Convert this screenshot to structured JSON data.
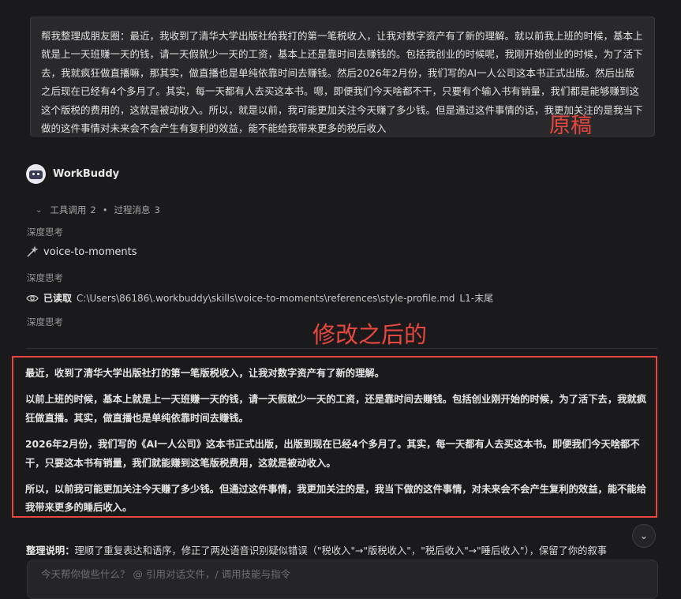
{
  "user_message": {
    "text": "帮我整理成朋友圈：最近，我收到了清华大学出版社给我打的第一笔税收入，让我对数字资产有了新的理解。就以前我上班的时候，基本上就是上一天班赚一天的钱，请一天假就少一天的工资，基本上还是靠时间去赚钱的。包括我创业的时候呢，我刚开始创业的时候，为了活下去，我就疯狂做直播嘛，那其实，做直播也是单纯依靠时间去赚钱。然后2026年2月份，我们写的AI一人公司这本书正式出版。然后出版之后现在已经有4个多月了。其实，每一天都有人去买这本书。嗯，即便我们今天啥都不干，只要有个输入书有销量，我们都是能够赚到这这个版税的费用的，这就是被动收入。所以，就是以前，我可能更加关注今天赚了多少钱。但是通过这件事情的话，我更加关注的是我当下做的这件事情对未来会不会产生有复利的效益，能不能给我带来更多的税后收入"
  },
  "annotations": {
    "original": "原稿",
    "modified": "修改之后的",
    "color": "#e8473f"
  },
  "assistant": {
    "name": "WorkBuddy",
    "tool_calls_label": "工具调用",
    "tool_calls_count": "2",
    "separator": "•",
    "process_label": "过程消息",
    "process_count": "3",
    "thinking_label": "深度思考",
    "skill_name": "voice-to-moments",
    "read_label": "已读取",
    "read_path": "C:\\Users\\86186\\.workbuddy\\skills\\voice-to-moments\\references\\style-profile.md",
    "read_range": "L1-末尾"
  },
  "result": {
    "paragraphs": [
      "最近，收到了清华大学出版社打的第一笔版税收入，让我对数字资产有了新的理解。",
      "以前上班的时候，基本上就是上一天班赚一天的钱，请一天假就少一天的工资，还是靠时间去赚钱。包括创业刚开始的时候，为了活下去，我就疯狂做直播。其实，做直播也是单纯依靠时间去赚钱。",
      "2026年2月份，我们写的《AI一人公司》这本书正式出版，出版到现在已经4个多月了。其实，每一天都有人去买这本书。即便我们今天啥都不干，只要这本书有销量，我们就能赚到这笔版税费用，这就是被动收入。",
      "所以，以前我可能更加关注今天赚了多少钱。但通过这件事情，我更加关注的是，我当下做的这件事情，对未来会不会产生复利的效益，能不能给我带来更多的睡后收入。"
    ]
  },
  "explanation": {
    "label": "整理说明：",
    "text": "理顺了重复表达和语序，修正了两处语音识别疑似错误（\"税收入\"→\"版税收入\"，\"税后收入\"→\"睡后收入\"），保留了你的叙事"
  },
  "input": {
    "placeholder": "今天帮你做些什么？ @ 引用对话文件，/ 调用技能与指令"
  },
  "icons": {
    "chevron": "chevron-down-icon",
    "skill": "wand-icon",
    "read": "eye-icon",
    "scroll": "chevron-down-icon"
  }
}
